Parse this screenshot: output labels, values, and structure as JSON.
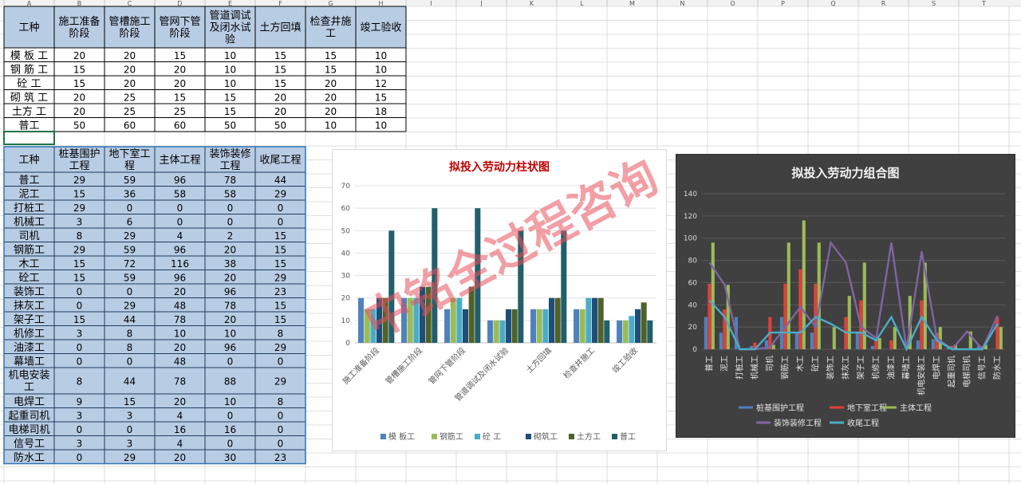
{
  "col_letters": [
    "A",
    "B",
    "C",
    "D",
    "E",
    "F",
    "G",
    "H",
    "I",
    "J",
    "K",
    "L",
    "M",
    "N",
    "O",
    "P",
    "Q",
    "R",
    "S",
    "T"
  ],
  "table1": {
    "headers": [
      "工种",
      "施工准备阶段",
      "管槽施工阶段",
      "管网下管阶段",
      "管道调试及闭水试验",
      "土方回填",
      "检查井施工",
      "竣工验收"
    ],
    "rows": [
      {
        "name": "模 板 工",
        "values": [
          "20",
          "20",
          "15",
          "10",
          "15",
          "15",
          "10"
        ]
      },
      {
        "name": "钢 筋 工",
        "values": [
          "15",
          "20",
          "20",
          "10",
          "15",
          "15",
          "10"
        ]
      },
      {
        "name": "砼     工",
        "values": [
          "15",
          "20",
          "20",
          "10",
          "15",
          "20",
          "12"
        ]
      },
      {
        "name": "砌 筑 工",
        "values": [
          "20",
          "25",
          "15",
          "15",
          "20",
          "20",
          "15"
        ]
      },
      {
        "name": "土方 工",
        "values": [
          "20",
          "25",
          "25",
          "15",
          "20",
          "20",
          "18"
        ]
      },
      {
        "name": "普工",
        "values": [
          "50",
          "60",
          "60",
          "50",
          "50",
          "10",
          "10"
        ]
      }
    ]
  },
  "table2": {
    "headers": [
      "工种",
      "桩基围护工程",
      "地下室工程",
      "主体工程",
      "装饰装修工程",
      "收尾工程"
    ],
    "rows": [
      {
        "name": "普工",
        "values": [
          "29",
          "59",
          "96",
          "78",
          "44"
        ]
      },
      {
        "name": "泥工",
        "values": [
          "15",
          "36",
          "58",
          "58",
          "29"
        ]
      },
      {
        "name": "打桩工",
        "values": [
          "29",
          "0",
          "0",
          "0",
          "0"
        ]
      },
      {
        "name": "机械工",
        "values": [
          "3",
          "6",
          "0",
          "0",
          "0"
        ]
      },
      {
        "name": "司机",
        "values": [
          "8",
          "29",
          "4",
          "2",
          "15"
        ]
      },
      {
        "name": "钢筋工",
        "values": [
          "29",
          "59",
          "96",
          "20",
          "15"
        ]
      },
      {
        "name": "木工",
        "values": [
          "15",
          "72",
          "116",
          "38",
          "15"
        ]
      },
      {
        "name": "砼工",
        "values": [
          "15",
          "59",
          "96",
          "20",
          "29"
        ]
      },
      {
        "name": "装饰工",
        "values": [
          "0",
          "0",
          "20",
          "96",
          "23"
        ]
      },
      {
        "name": "抹灰工",
        "values": [
          "0",
          "29",
          "48",
          "78",
          "15"
        ]
      },
      {
        "name": "架子工",
        "values": [
          "15",
          "44",
          "78",
          "20",
          "15"
        ]
      },
      {
        "name": "机修工",
        "values": [
          "3",
          "8",
          "10",
          "10",
          "8"
        ]
      },
      {
        "name": "油漆工",
        "values": [
          "0",
          "8",
          "20",
          "96",
          "29"
        ]
      },
      {
        "name": "幕墙工",
        "values": [
          "0",
          "0",
          "48",
          "0",
          "0"
        ]
      },
      {
        "name": "机电安装工",
        "values": [
          "8",
          "44",
          "78",
          "88",
          "29"
        ]
      },
      {
        "name": "电焊工",
        "values": [
          "9",
          "15",
          "20",
          "10",
          "8"
        ]
      },
      {
        "name": "起重司机",
        "values": [
          "3",
          "3",
          "4",
          "0",
          "0"
        ]
      },
      {
        "name": "电梯司机",
        "values": [
          "0",
          "0",
          "16",
          "16",
          "0"
        ]
      },
      {
        "name": "信号工",
        "values": [
          "3",
          "3",
          "4",
          "0",
          "0"
        ]
      },
      {
        "name": "防水工",
        "values": [
          "0",
          "29",
          "20",
          "30",
          "23"
        ]
      }
    ]
  },
  "watermark": "中铭全过程咨询",
  "colors": {
    "grid": "#d4d4d4",
    "header_fill": "#b8cce4",
    "selection": "#217346"
  },
  "chart_data": [
    {
      "type": "bar",
      "title": "拟投入劳动力柱状图",
      "categories": [
        "施工准备阶段",
        "管槽施工阶段",
        "管网下管阶段",
        "管道调试及闭水试验",
        "土方回填",
        "检查井施工",
        "竣工验收"
      ],
      "ylim": [
        0,
        70
      ],
      "yticks": [
        "0",
        "10",
        "20",
        "30",
        "40",
        "50",
        "60",
        "70"
      ],
      "grid": true,
      "legend": "bottom",
      "series": [
        {
          "name": "模 板工",
          "color": "#4f81bd",
          "values": [
            20,
            20,
            15,
            10,
            15,
            15,
            10
          ]
        },
        {
          "name": "钢筋工",
          "color": "#9bbb59",
          "values": [
            15,
            20,
            20,
            10,
            15,
            15,
            10
          ]
        },
        {
          "name": "砼  工",
          "color": "#4bacc6",
          "values": [
            15,
            20,
            20,
            10,
            15,
            20,
            12
          ]
        },
        {
          "name": "砌筑工",
          "color": "#1f4e79",
          "values": [
            20,
            25,
            15,
            15,
            20,
            20,
            15
          ]
        },
        {
          "name": "土方工",
          "color": "#4f6228",
          "values": [
            20,
            25,
            25,
            15,
            20,
            20,
            18
          ]
        },
        {
          "name": "普工",
          "color": "#215f6b",
          "values": [
            50,
            60,
            60,
            50,
            50,
            10,
            10
          ]
        }
      ]
    },
    {
      "type": "bar",
      "title": "拟投入劳动力组合图",
      "categories": [
        "普工",
        "泥工",
        "打桩工",
        "机械工",
        "司机",
        "钢筋工",
        "木工",
        "砼工",
        "装饰工",
        "抹灰工",
        "架子工",
        "机修工",
        "油漆工",
        "幕墙工",
        "机电安装工",
        "电焊工",
        "起重司机",
        "电梯司机",
        "信号工",
        "防水工"
      ],
      "ylim": [
        0,
        140
      ],
      "yticks": [
        "0",
        "20",
        "40",
        "60",
        "80",
        "100",
        "120",
        "140"
      ],
      "grid": true,
      "legend": "bottom",
      "series": [
        {
          "name": "桩基围护工程",
          "kind": "bar",
          "color": "#4f81bd",
          "values": [
            29,
            15,
            29,
            3,
            8,
            29,
            15,
            15,
            0,
            0,
            15,
            3,
            0,
            0,
            8,
            9,
            3,
            0,
            3,
            0
          ]
        },
        {
          "name": "地下室工程",
          "kind": "bar",
          "color": "#e0403a",
          "values": [
            59,
            36,
            0,
            6,
            29,
            59,
            72,
            59,
            0,
            29,
            44,
            8,
            8,
            0,
            44,
            15,
            3,
            0,
            3,
            29
          ]
        },
        {
          "name": "主体工程",
          "kind": "bar",
          "color": "#9bbb59",
          "values": [
            96,
            58,
            0,
            0,
            4,
            96,
            116,
            96,
            20,
            48,
            78,
            10,
            20,
            48,
            78,
            20,
            4,
            16,
            4,
            20
          ]
        },
        {
          "name": "装饰装修工程",
          "kind": "line",
          "color": "#8064a2",
          "values": [
            78,
            58,
            0,
            0,
            2,
            20,
            38,
            20,
            96,
            78,
            20,
            10,
            96,
            0,
            88,
            10,
            0,
            16,
            0,
            30
          ]
        },
        {
          "name": "收尾工程",
          "kind": "line",
          "color": "#4bacc6",
          "values": [
            44,
            29,
            0,
            0,
            15,
            15,
            15,
            29,
            23,
            15,
            15,
            8,
            29,
            0,
            29,
            8,
            0,
            0,
            0,
            23
          ]
        }
      ]
    }
  ]
}
